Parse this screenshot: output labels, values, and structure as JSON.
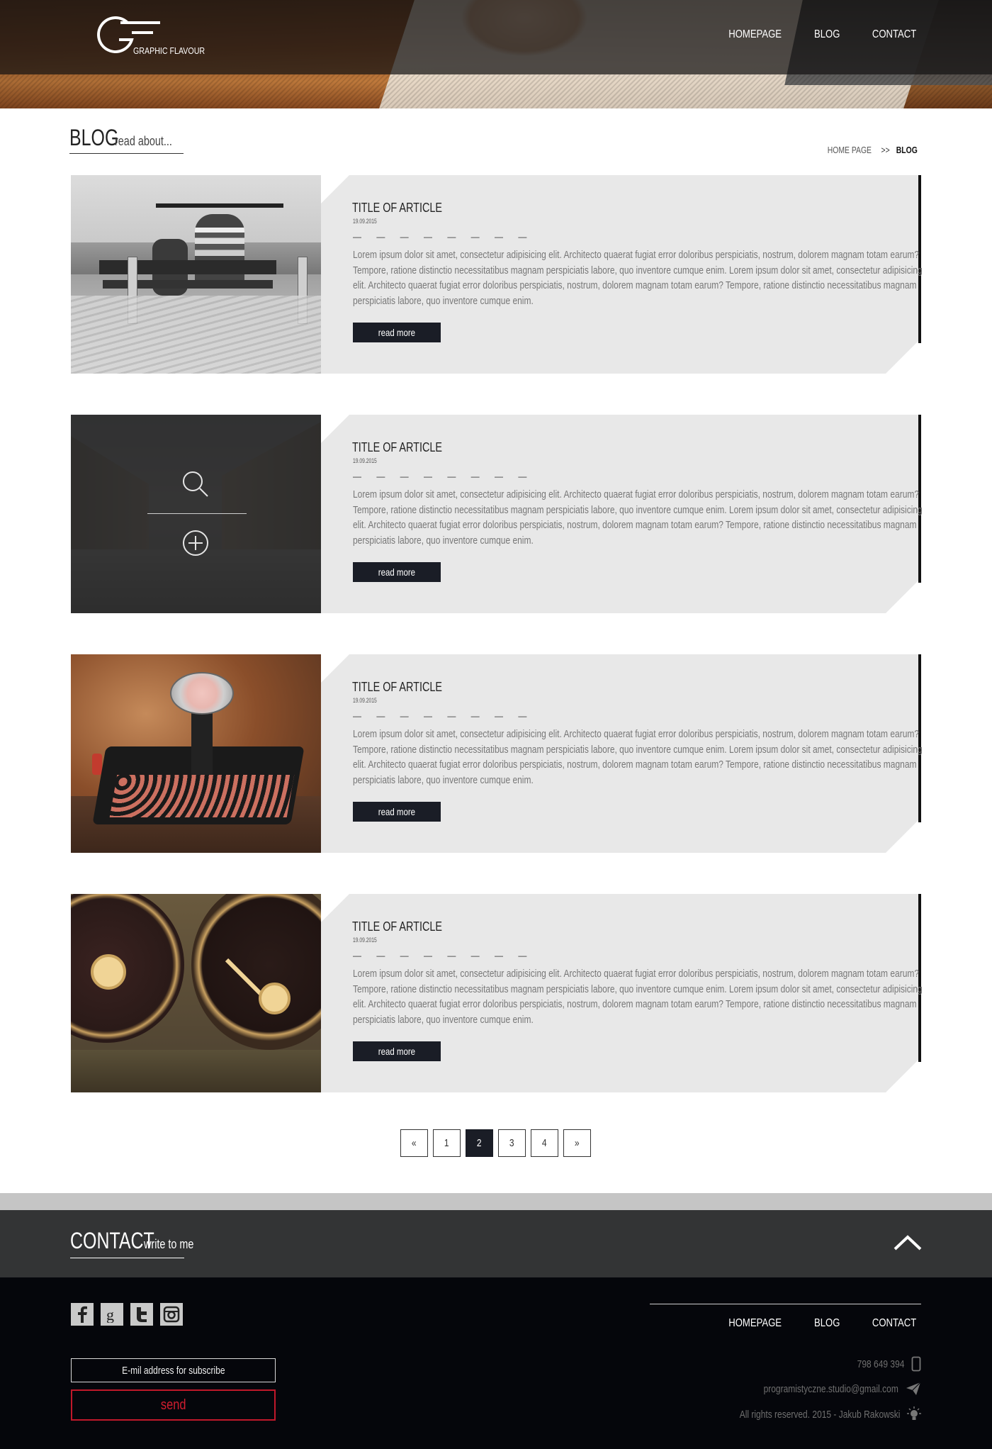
{
  "brand": {
    "logo_mark": "GF",
    "name": "GRAPHIC FLAVOUR"
  },
  "nav": {
    "items": [
      "HOMEPAGE",
      "BLOG",
      "CONTACT"
    ]
  },
  "page": {
    "title": "BLOG",
    "subtitle": "read about..."
  },
  "breadcrumb": {
    "home": "HOME PAGE",
    "separator": ">>",
    "current": "BLOG"
  },
  "articles": [
    {
      "title": "TITLE OF ARTICLE",
      "date": "19.09.2015",
      "dashes": "— — — — — — — —",
      "body": "Lorem ipsum dolor sit amet, consectetur adipisicing elit. Architecto quaerat fugiat error doloribus perspiciatis, nostrum, dolorem magnam totam earum? Tempore, ratione distinctio necessitatibus magnam perspiciatis labore, quo inventore cumque enim. Lorem ipsum dolor sit amet, consectetur adipisicing elit. Architecto quaerat fugiat error doloribus perspiciatis, nostrum, dolorem magnam totam earum? Tempore, ratione distinctio necessitatibus magnam perspiciatis labore, quo inventore cumque enim.",
      "button": "read more",
      "image": "beach-bench-photo"
    },
    {
      "title": "TITLE OF ARTICLE",
      "date": "19.09.2015",
      "dashes": "— — — — — — — —",
      "body": "Lorem ipsum dolor sit amet, consectetur adipisicing elit. Architecto quaerat fugiat error doloribus perspiciatis, nostrum, dolorem magnam totam earum? Tempore, ratione distinctio necessitatibus magnam perspiciatis labore, quo inventore cumque enim. Lorem ipsum dolor sit amet, consectetur adipisicing elit. Architecto quaerat fugiat error doloribus perspiciatis, nostrum, dolorem magnam totam earum? Tempore, ratione distinctio necessitatibus magnam perspiciatis labore, quo inventore cumque enim.",
      "button": "read more",
      "image": "canal-photo-hover"
    },
    {
      "title": "TITLE OF ARTICLE",
      "date": "19.09.2015",
      "dashes": "— — — — — — — —",
      "body": "Lorem ipsum dolor sit amet, consectetur adipisicing elit. Architecto quaerat fugiat error doloribus perspiciatis, nostrum, dolorem magnam totam earum? Tempore, ratione distinctio necessitatibus magnam perspiciatis labore, quo inventore cumque enim. Lorem ipsum dolor sit amet, consectetur adipisicing elit. Architecto quaerat fugiat error doloribus perspiciatis, nostrum, dolorem magnam totam earum? Tempore, ratione distinctio necessitatibus magnam perspiciatis labore, quo inventore cumque enim.",
      "button": "read more",
      "image": "typewriter-photo"
    },
    {
      "title": "TITLE OF ARTICLE",
      "date": "19.09.2015",
      "dashes": "— — — — — — — —",
      "body": "Lorem ipsum dolor sit amet, consectetur adipisicing elit. Architecto quaerat fugiat error doloribus perspiciatis, nostrum, dolorem magnam totam earum? Tempore, ratione distinctio necessitatibus magnam perspiciatis labore, quo inventore cumque enim. Lorem ipsum dolor sit amet, consectetur adipisicing elit. Architecto quaerat fugiat error doloribus perspiciatis, nostrum, dolorem magnam totam earum? Tempore, ratione distinctio necessitatibus magnam perspiciatis labore, quo inventore cumque enim.",
      "button": "read more",
      "image": "gauges-photo"
    }
  ],
  "pagination": {
    "first": "«",
    "pages": [
      "1",
      "2",
      "3",
      "4"
    ],
    "current": "2",
    "last": "»"
  },
  "contact": {
    "title": "CONTACT",
    "subtitle": "write to me"
  },
  "footer": {
    "social_icons": [
      "facebook-icon",
      "google-plus-icon",
      "twitter-icon",
      "instagram-icon"
    ],
    "subscribe_placeholder": "E-mil address for subscribe",
    "send_label": "send",
    "nav": [
      "HOMEPAGE",
      "BLOG",
      "CONTACT"
    ],
    "phone": "798 649 394",
    "email": "programistyczne.studio@gmail.com",
    "copyright": "All rights reserved. 2015 - Jakub Rakowski"
  },
  "colors": {
    "accent_dark": "#1a1d26",
    "panel_gray": "#e8e8e8",
    "send_red": "#d11d2f",
    "footer_bg": "#05060b",
    "contact_bar": "#333435"
  }
}
